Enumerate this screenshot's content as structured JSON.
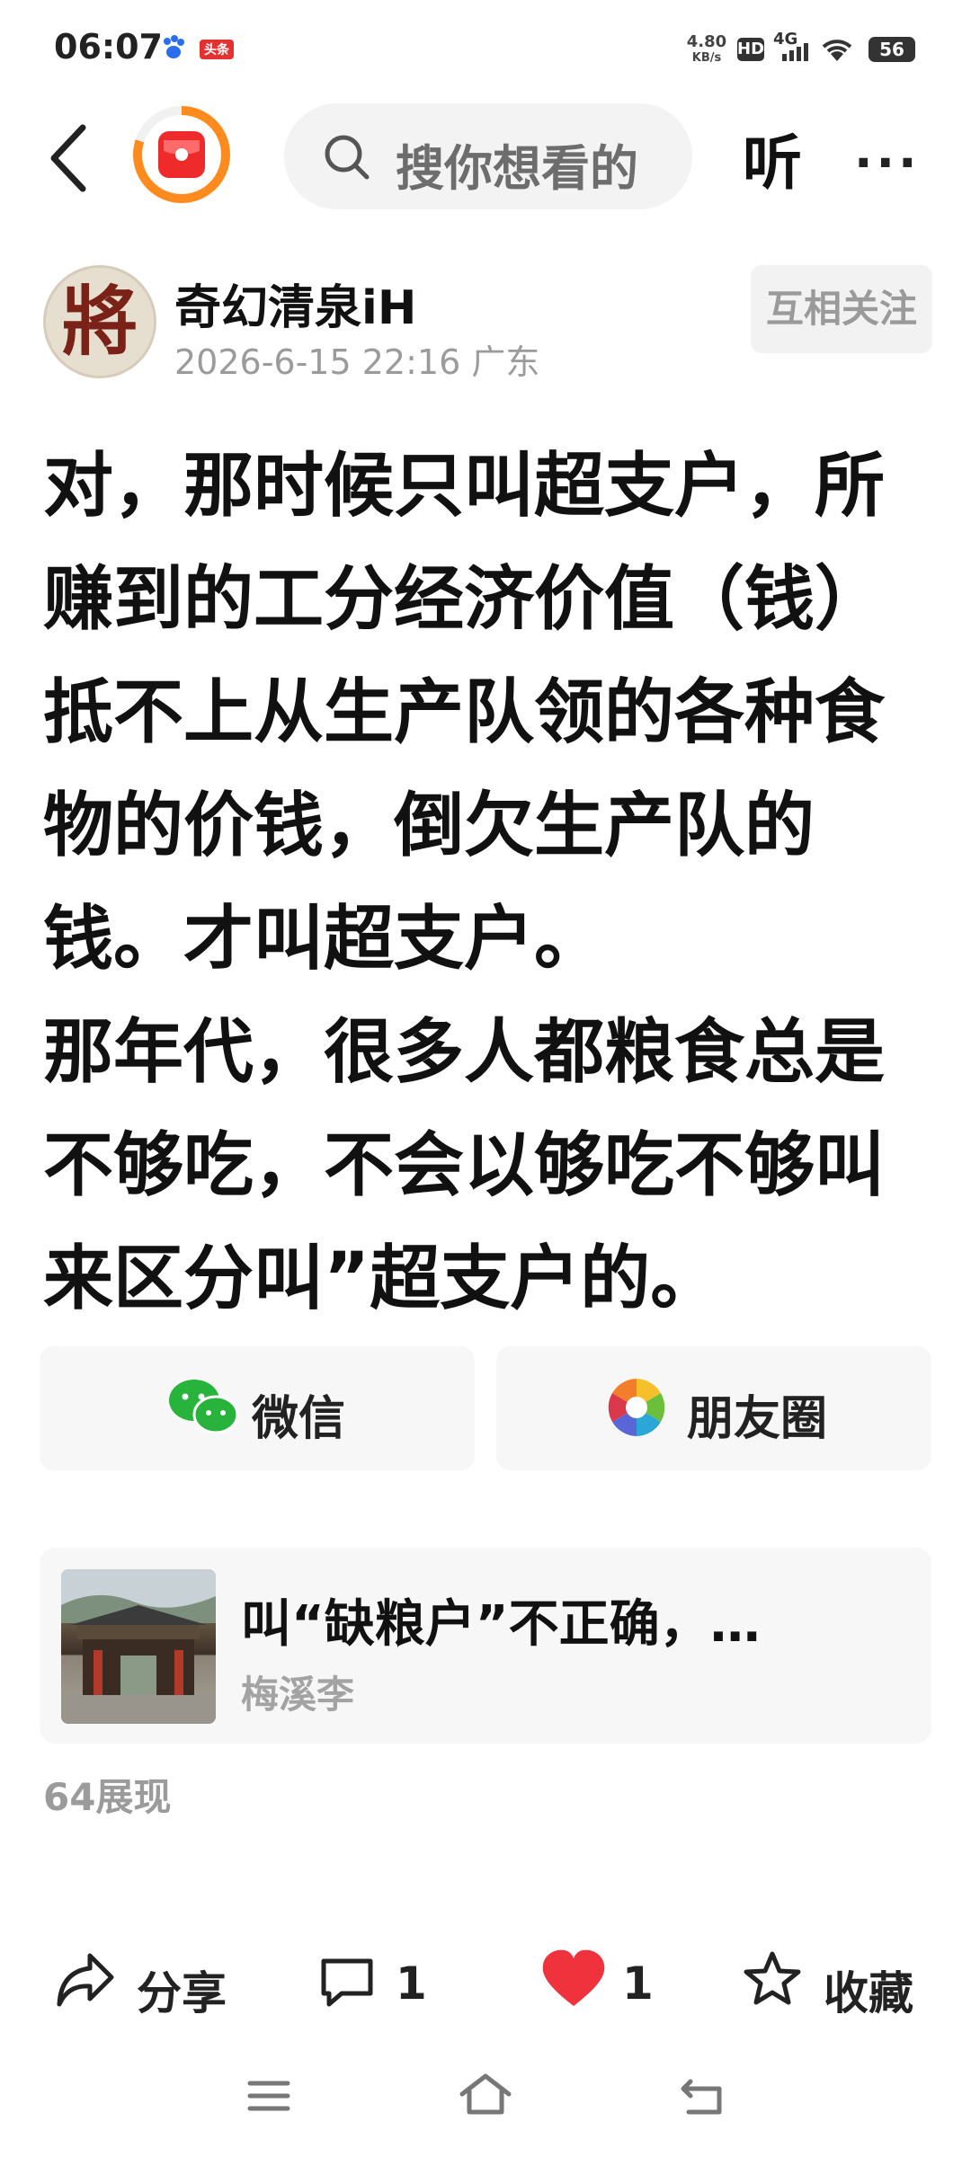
{
  "status_bar": {
    "time": "06:07",
    "ad_badge": "头条",
    "net_rate_value": "4.80",
    "net_rate_unit": "KB/s",
    "hd": "HD",
    "signal": "4G",
    "battery": "56"
  },
  "top_nav": {
    "search_placeholder": "搜你想看的",
    "listen_label": "听",
    "more_label": "···",
    "accent_color": "#ff8a1e"
  },
  "author": {
    "name": "奇幻清泉iH",
    "date_location": "2026-6-15 22:16 广东",
    "follow_label": "互相关注",
    "avatar_glyph": "將"
  },
  "post": {
    "paragraph_1": "对，那时候只叫超支户，所赚到的工分经济价值（钱）抵不上从生产队领的各种食物的价钱，倒欠生产队的钱。才叫超支户。",
    "paragraph_2": "那年代，很多人都粮食总是不够吃，不会以够吃不够叫来区分叫”超支户的。"
  },
  "share": {
    "wechat_label": "微信",
    "moments_label": "朋友圈"
  },
  "related": {
    "title": "叫“缺粮户”不正确，…",
    "author": "梅溪李"
  },
  "views": "64展现",
  "actions": {
    "share_label": "分享",
    "comment_count": "1",
    "like_count": "1",
    "favorite_label": "收藏",
    "like_color": "#f0323c"
  }
}
